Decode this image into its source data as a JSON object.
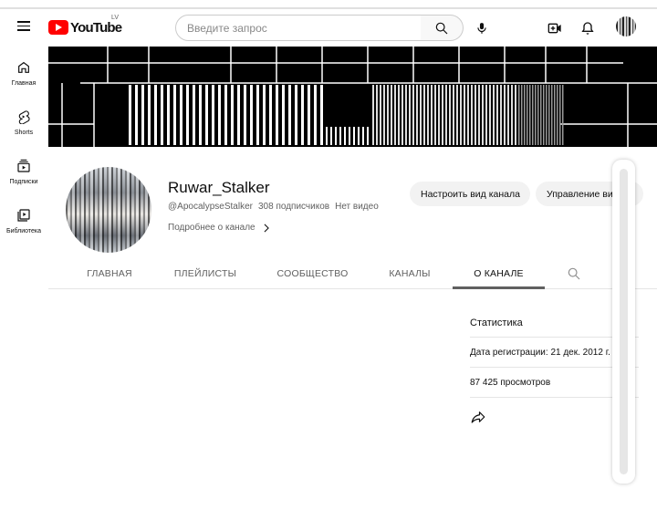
{
  "header": {
    "logo_text": "YouTube",
    "region_code": "LV",
    "search_placeholder": "Введите запрос"
  },
  "sidebar": {
    "items": [
      {
        "label": "Главная",
        "icon": "home-icon"
      },
      {
        "label": "Shorts",
        "icon": "shorts-icon"
      },
      {
        "label": "Подписки",
        "icon": "subscriptions-icon"
      },
      {
        "label": "Библиотека",
        "icon": "library-icon"
      }
    ]
  },
  "channel": {
    "name": "Ruwar_Stalker",
    "handle": "@ApocalypseStalker",
    "subscribers": "308 подписчиков",
    "videos": "Нет видео",
    "more_link": "Подробнее о канале",
    "customize_button": "Настроить вид канала",
    "manage_button": "Управление видео"
  },
  "tabs": [
    {
      "label": "ГЛАВНАЯ",
      "active": false
    },
    {
      "label": "ПЛЕЙЛИСТЫ",
      "active": false
    },
    {
      "label": "СООБЩЕСТВО",
      "active": false
    },
    {
      "label": "КАНАЛЫ",
      "active": false
    },
    {
      "label": "О КАНАЛЕ",
      "active": true
    }
  ],
  "about": {
    "stats_title": "Статистика",
    "joined": "Дата регистрации: 21 дек. 2012 г.",
    "views": "87 425 просмотров"
  },
  "colors": {
    "brand_red": "#ff0000",
    "text_primary": "#0f0f0f",
    "text_secondary": "#606060",
    "pill_bg": "#f2f2f2"
  }
}
